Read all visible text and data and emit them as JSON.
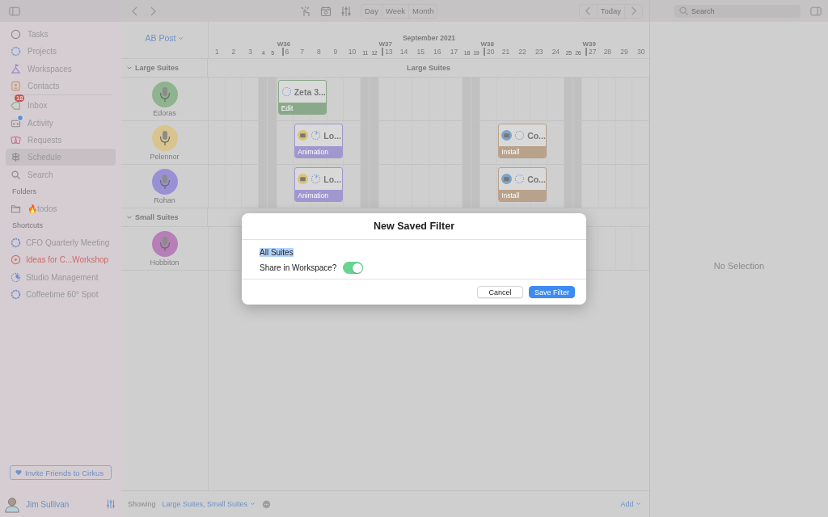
{
  "sidebar": {
    "nav": [
      {
        "label": "Tasks",
        "selected": false
      },
      {
        "label": "Projects",
        "selected": false
      },
      {
        "label": "Workspaces",
        "selected": false
      },
      {
        "label": "Contacts",
        "selected": false
      }
    ],
    "nav2": [
      {
        "label": "Inbox",
        "badge": "18",
        "selected": false
      },
      {
        "label": "Activity",
        "dot": true,
        "selected": false
      },
      {
        "label": "Requests",
        "selected": false
      },
      {
        "label": "Schedule",
        "selected": true
      },
      {
        "label": "Search",
        "selected": false
      }
    ],
    "folders_heading": "Folders",
    "folders": [
      {
        "label": "🔥todos"
      }
    ],
    "shortcuts_heading": "Shortcuts",
    "shortcuts": [
      {
        "label": "CFO Quarterly Meeting",
        "kind": "project",
        "color": "#6c8fcf"
      },
      {
        "label": "Ideas for C...Workshop",
        "kind": "video",
        "color": "#cf6a6a"
      },
      {
        "label": "Studio Management",
        "kind": "started",
        "color": "#6c8fcf"
      },
      {
        "label": "Coffeetime 60° Spot",
        "kind": "project",
        "color": "#6c8fcf"
      }
    ],
    "invite_button": "Invite Friends to Cirkus",
    "user": "Jim Sullivan"
  },
  "toolbar": {
    "views": [
      {
        "label": "Day",
        "selected": false
      },
      {
        "label": "Week",
        "selected": false
      },
      {
        "label": "Month",
        "selected": false
      }
    ],
    "today": "Today"
  },
  "search": {
    "placeholder": "Search"
  },
  "schedule": {
    "project": "AB Post",
    "month": "September 2021",
    "days": [
      {
        "label": "1",
        "weekend": false
      },
      {
        "label": "2",
        "weekend": false
      },
      {
        "label": "3",
        "weekend": false
      },
      {
        "label": "4",
        "weekend": true
      },
      {
        "label": "5",
        "weekend": true
      },
      {
        "label": "6",
        "weekend": false,
        "week": "W36"
      },
      {
        "label": "7",
        "weekend": false
      },
      {
        "label": "8",
        "weekend": false
      },
      {
        "label": "9",
        "weekend": false
      },
      {
        "label": "10",
        "weekend": false
      },
      {
        "label": "11",
        "weekend": true
      },
      {
        "label": "12",
        "weekend": true
      },
      {
        "label": "13",
        "weekend": false,
        "week": "W37"
      },
      {
        "label": "14",
        "weekend": false
      },
      {
        "label": "15",
        "weekend": false
      },
      {
        "label": "16",
        "weekend": false
      },
      {
        "label": "17",
        "weekend": false
      },
      {
        "label": "18",
        "weekend": true
      },
      {
        "label": "19",
        "weekend": true
      },
      {
        "label": "20",
        "weekend": false,
        "week": "W38"
      },
      {
        "label": "21",
        "weekend": false
      },
      {
        "label": "22",
        "weekend": false
      },
      {
        "label": "23",
        "weekend": false
      },
      {
        "label": "24",
        "weekend": false
      },
      {
        "label": "25",
        "weekend": true
      },
      {
        "label": "26",
        "weekend": true
      },
      {
        "label": "27",
        "weekend": false,
        "week": "W39"
      },
      {
        "label": "28",
        "weekend": false
      },
      {
        "label": "29",
        "weekend": false
      },
      {
        "label": "30",
        "weekend": false
      }
    ],
    "sections": [
      {
        "name": "Large Suites",
        "timeline_label": "Large Suites",
        "expanded": true,
        "resources": [
          {
            "name": "Edoras",
            "color": "#8fb38f",
            "events": [
              {
                "title": "Zeta 3...",
                "label": "Edit",
                "color": "#8aa98a",
                "started": false
              }
            ]
          },
          {
            "name": "Pelennor",
            "color": "#d9c48f",
            "events": [
              {
                "title": "Lo...",
                "label": "Animation",
                "color": "#a197cf",
                "assignee": {
                  "color": "#d9c27a"
                },
                "started": true
              },
              {
                "title": "Co...",
                "label": "Install",
                "color": "#b8a28b",
                "assignee": {
                  "color": "#7fa3c4"
                },
                "started": false
              }
            ]
          },
          {
            "name": "Rohan",
            "color": "#9a90d6",
            "events": [
              {
                "title": "Lo...",
                "label": "Animation",
                "color": "#a197cf",
                "assignee": {
                  "color": "#d9c27a"
                },
                "started": true
              },
              {
                "title": "Co...",
                "label": "Install",
                "color": "#b8a28b",
                "assignee": {
                  "color": "#7fa3c4"
                },
                "started": false
              }
            ]
          }
        ]
      },
      {
        "name": "Small Suites",
        "expanded": true,
        "resources": [
          {
            "name": "Hobbiton",
            "color": "#b77fb7"
          }
        ]
      }
    ]
  },
  "details": {
    "empty": "No Selection"
  },
  "footer": {
    "showing_label": "Showing",
    "filter": "Large Suites, Small Suites",
    "add": "Add"
  },
  "dialog": {
    "title": "New Saved Filter",
    "name_value": "All Suites",
    "share_label": "Share in Workspace?",
    "share_on": true,
    "cancel": "Cancel",
    "save": "Save Filter"
  }
}
